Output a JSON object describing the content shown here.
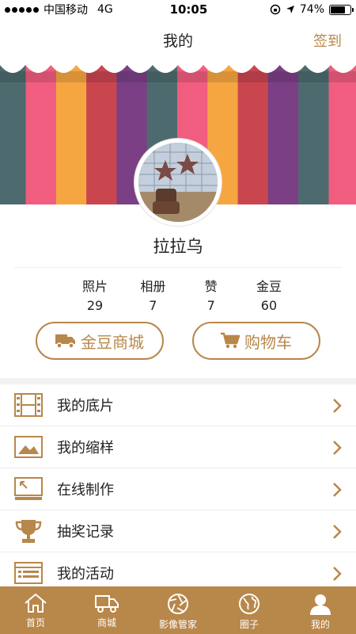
{
  "status_bar": {
    "carrier": "中国移动",
    "network": "4G",
    "time": "10:05",
    "battery_text": "74%",
    "battery_level": 0.74
  },
  "header": {
    "title": "我的",
    "checkin_label": "签到"
  },
  "colors": {
    "accent": "#b8874a",
    "stripes": [
      "#4d6b6e",
      "#f05d7f",
      "#f6a641",
      "#c9464f",
      "#7b3f86",
      "#4d6b6e",
      "#f05d7f",
      "#f6a641",
      "#c9464f",
      "#7b3f86",
      "#4d6b6e",
      "#f05d7f"
    ]
  },
  "profile": {
    "username": "拉拉乌"
  },
  "stats": [
    {
      "label": "照片",
      "value": "29"
    },
    {
      "label": "相册",
      "value": "7"
    },
    {
      "label": "赞",
      "value": "7"
    },
    {
      "label": "金豆",
      "value": "60"
    }
  ],
  "actions": {
    "mall_label": "金豆商城",
    "cart_label": "购物车"
  },
  "menu": [
    {
      "label": "我的底片",
      "icon": "film-icon"
    },
    {
      "label": "我的缩样",
      "icon": "image-icon"
    },
    {
      "label": "在线制作",
      "icon": "monitor-icon"
    },
    {
      "label": "抽奖记录",
      "icon": "trophy-icon"
    },
    {
      "label": "我的活动",
      "icon": "list-icon"
    }
  ],
  "tabs": [
    {
      "label": "首页",
      "icon": "home-icon"
    },
    {
      "label": "商城",
      "icon": "truck-icon"
    },
    {
      "label": "影像管家",
      "icon": "aperture-icon"
    },
    {
      "label": "圈子",
      "icon": "globe-icon"
    },
    {
      "label": "我的",
      "icon": "user-icon"
    }
  ]
}
